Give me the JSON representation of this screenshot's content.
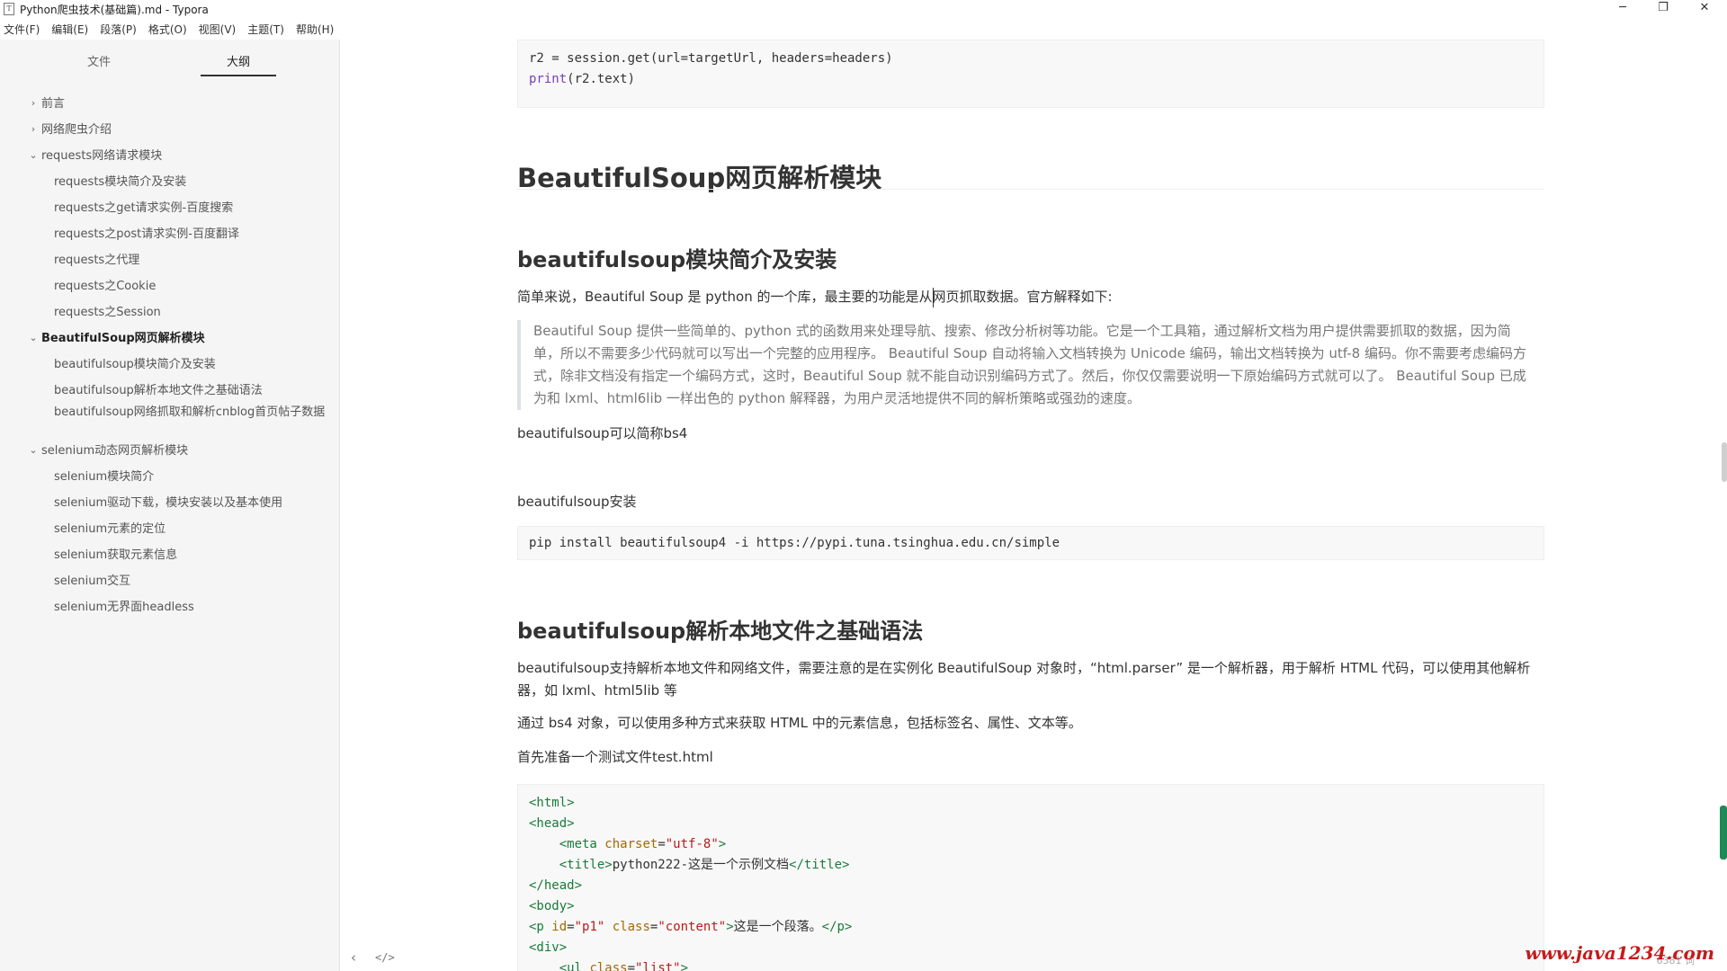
{
  "window": {
    "title": "Python爬虫技术(基础篇).md - Typora",
    "icon": "T",
    "controls": {
      "minimize": "─",
      "restore": "❐",
      "close": "✕"
    }
  },
  "menu": [
    "文件(F)",
    "编辑(E)",
    "段落(P)",
    "格式(O)",
    "视图(V)",
    "主题(T)",
    "帮助(H)"
  ],
  "sidebar": {
    "tabs": [
      "文件",
      "大纲"
    ],
    "active_tab": "大纲",
    "outline": [
      {
        "label": "前言",
        "level": 1,
        "chevron": "›"
      },
      {
        "label": "网络爬虫介绍",
        "level": 1,
        "chevron": "›"
      },
      {
        "label": "requests网络请求模块",
        "level": 1,
        "chevron": "⌄"
      },
      {
        "label": "requests模块简介及安装",
        "level": 2
      },
      {
        "label": "requests之get请求实例-百度搜索",
        "level": 2
      },
      {
        "label": "requests之post请求实例-百度翻译",
        "level": 2
      },
      {
        "label": "requests之代理",
        "level": 2
      },
      {
        "label": "requests之Cookie",
        "level": 2
      },
      {
        "label": "requests之Session",
        "level": 2
      },
      {
        "label": "BeautifulSoup网页解析模块",
        "level": 1,
        "chevron": "⌄",
        "active": true
      },
      {
        "label": "beautifulsoup模块简介及安装",
        "level": 2
      },
      {
        "label": "beautifulsoup解析本地文件之基础语法",
        "level": 2
      },
      {
        "label": "beautifulsoup网络抓取和解析cnblog首页帖子数据",
        "level": 2
      },
      {
        "label": "selenium动态网页解析模块",
        "level": 1,
        "chevron": "⌄"
      },
      {
        "label": "selenium模块简介",
        "level": 2
      },
      {
        "label": "selenium驱动下载，模块安装以及基本使用",
        "level": 2
      },
      {
        "label": "selenium元素的定位",
        "level": 2
      },
      {
        "label": "selenium获取元素信息",
        "level": 2
      },
      {
        "label": "selenium交互",
        "level": 2
      },
      {
        "label": "selenium无界面headless",
        "level": 2
      }
    ],
    "footer": {
      "collapse": "‹",
      "source": "</>"
    }
  },
  "doc": {
    "code1": {
      "line1": "r2 = session.get(url=targetUrl, headers=headers)",
      "line2_fn": "print",
      "line2_rest": "(r2.text)"
    },
    "h1": "BeautifulSoup网页解析模块",
    "h2_intro": "beautifulsoup模块简介及安装",
    "intro": "简单来说，Beautiful Soup 是 python 的一个库，最主要的功能是从网页抓取数据。官方解释如下:",
    "quote": "Beautiful Soup 提供一些简单的、python 式的函数用来处理导航、搜索、修改分析树等功能。它是一个工具箱，通过解析文档为用户提供需要抓取的数据，因为简单，所以不需要多少代码就可以写出一个完整的应用程序。 Beautiful Soup 自动将输入文档转换为 Unicode 编码，输出文档转换为 utf-8 编码。你不需要考虑编码方式，除非文档没有指定一个编码方式，这时，Beautiful Soup 就不能自动识别编码方式了。然后，你仅仅需要说明一下原始编码方式就可以了。 Beautiful Soup 已成为和 lxml、html6lib 一样出色的 python 解释器，为用户灵活地提供不同的解析策略或强劲的速度。",
    "abbr": "beautifulsoup可以简称bs4",
    "install_label": "beautifulsoup安装",
    "install_cmd": "pip install beautifulsoup4 -i https://pypi.tuna.tsinghua.edu.cn/simple",
    "h2_local": "beautifulsoup解析本地文件之基础语法",
    "local_p1": "beautifulsoup支持解析本地文件和网络文件，需要注意的是在实例化 BeautifulSoup 对象时，“html.parser” 是一个解析器，用于解析 HTML 代码，可以使用其他解析器，如 lxml、html5lib 等",
    "local_p2": "通过 bs4 对象，可以使用多种方式来获取 HTML 中的元素信息，包括标签名、属性、文本等。",
    "local_p3": "首先准备一个测试文件test.html",
    "html_code": {
      "l1": "<html>",
      "l2": "<head>",
      "l3_indent": "    ",
      "l3_tag_open": "<meta ",
      "l3_attr": "charset",
      "l3_eq": "=",
      "l3_val": "\"utf-8\"",
      "l3_close": ">",
      "l4_indent": "    ",
      "l4_open": "<title>",
      "l4_text": "python222-这是一个示例文档",
      "l4_close": "</title>",
      "l5": "</head>",
      "l6": "<body>",
      "l7_open": "<p ",
      "l7_attr1": "id",
      "l7_val1": "\"p1\"",
      "l7_attr2": "class",
      "l7_val2": "\"content\"",
      "l7_gt": ">",
      "l7_text": "这是一个段落。",
      "l7_close": "</p>",
      "l8": "<div>",
      "l9_indent": "    ",
      "l9_open": "<ul ",
      "l9_attr": "class",
      "l9_val": "\"list\"",
      "l9_gt": ">"
    }
  },
  "status": {
    "word_count": "6381 词"
  },
  "watermark": "www.java1234.com",
  "colors": {
    "sidebar_bg": "#f5f5f5",
    "code_bg": "#f8f8f8",
    "watermark": "#c61a1a",
    "scroll_accent": "#1e8a55"
  }
}
